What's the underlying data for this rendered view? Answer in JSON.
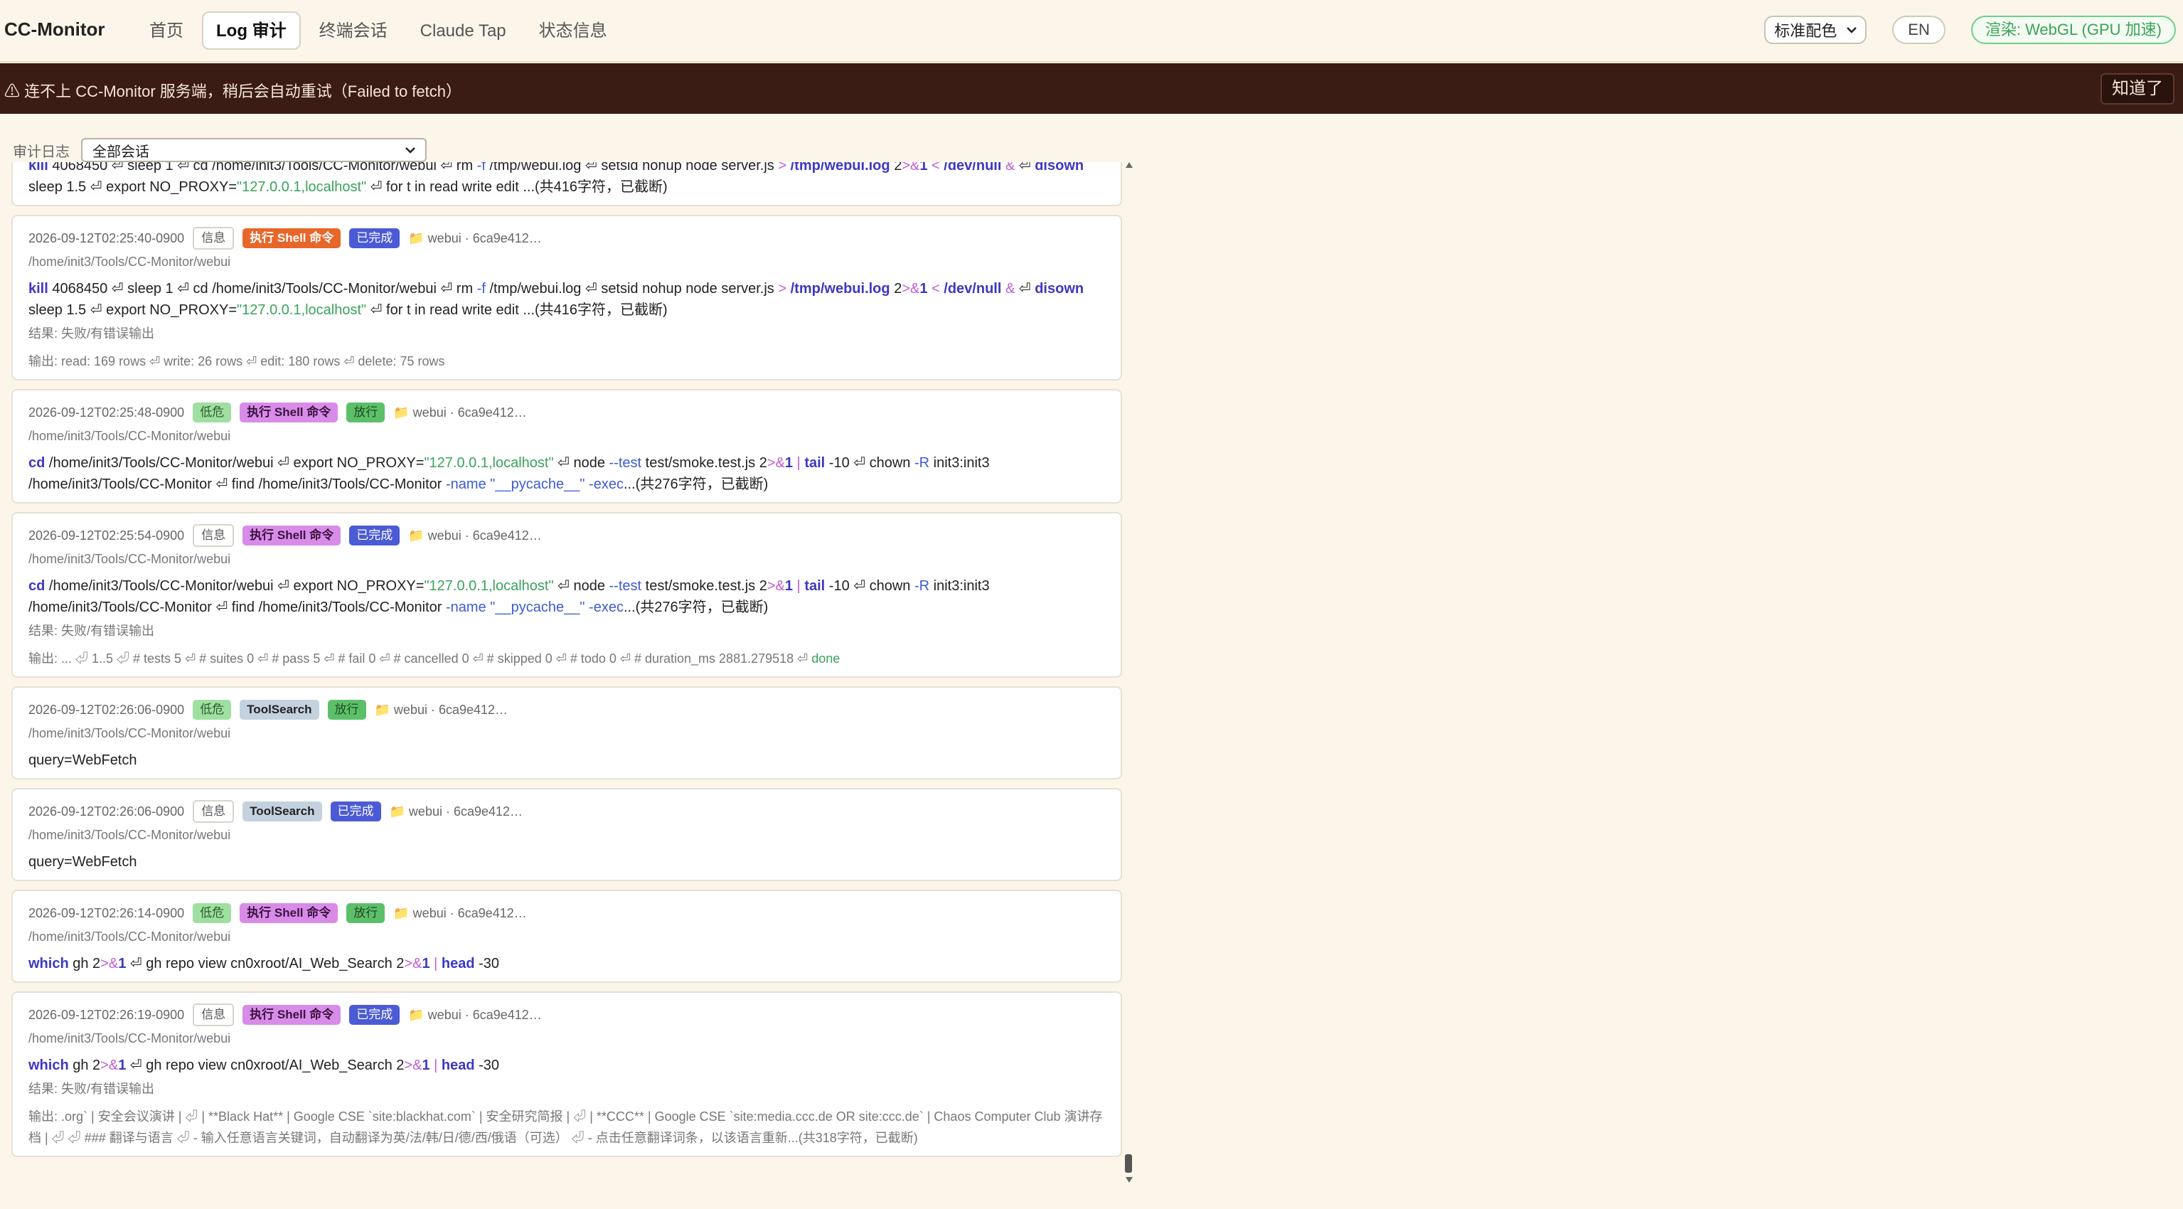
{
  "nav": {
    "brand": "CC-Monitor",
    "tabs": [
      {
        "label": "首页"
      },
      {
        "label": "Log 审计",
        "active": true
      },
      {
        "label": "终端会话"
      },
      {
        "label": "Claude Tap"
      },
      {
        "label": "状态信息"
      }
    ],
    "theme_select": "标准配色",
    "lang_button": "EN",
    "render_badge": "渲染: WebGL (GPU 加速)"
  },
  "banner": {
    "message": "⚠ 连不上 CC-Monitor 服务端，稍后会自动重试（Failed to fetch）",
    "ack_button": "知道了"
  },
  "filter": {
    "label": "审计日志",
    "selected": "全部会话"
  },
  "colors": {
    "accent_blue": "#4b5bd6",
    "danger_banner": "#3a1c15",
    "allow_green": "#5cc06a",
    "low_risk": "#9fe0a0",
    "shell_pink": "#d98be8",
    "shell_orange": "#e8662a"
  },
  "entries": [
    {
      "partial": true,
      "cmd_line1": "kill 4068450 ⏎ sleep 1 ⏎ cd /home/init3/Tools/CC-Monitor/webui ⏎ rm -f /tmp/webui.log ⏎ setsid nohup node server.js > /tmp/webui.log 2>&1 < /dev/null & ⏎ disown",
      "cmd_line2": "sleep 1.5 ⏎ export NO_PROXY=\"127.0.0.1,localhost\" ⏎ for t in read write edit ...(共416字符，已截断)"
    },
    {
      "time": "2026-09-12T02:25:40-0900",
      "level": "信息",
      "tool": "执行 Shell 命令",
      "status": "已完成",
      "folder": "📁 webui · 6ca9e412…",
      "path": "/home/init3/Tools/CC-Monitor/webui",
      "result": "结果: 失败/有错误输出",
      "output": "输出: read: 169 rows ⏎ write: 26 rows ⏎ edit: 180 rows ⏎ delete: 75 rows"
    },
    {
      "time": "2026-09-12T02:25:48-0900",
      "level": "低危",
      "tool": "执行 Shell 命令",
      "status": "放行",
      "folder": "📁 webui · 6ca9e412…",
      "path": "/home/init3/Tools/CC-Monitor/webui"
    },
    {
      "time": "2026-09-12T02:25:54-0900",
      "level": "信息",
      "tool": "执行 Shell 命令",
      "status": "已完成",
      "folder": "📁 webui · 6ca9e412…",
      "path": "/home/init3/Tools/CC-Monitor/webui",
      "result": "结果: 失败/有错误输出",
      "output_prefix": "输出: ... ⏎ 1..5 ⏎ # tests 5 ⏎ # suites 0 ⏎ # pass 5 ⏎ # fail 0 ⏎ # cancelled 0 ⏎ # skipped 0 ⏎ # todo 0 ⏎ # duration_ms 2881.279518 ⏎ ",
      "output_done": "done"
    },
    {
      "time": "2026-09-12T02:26:06-0900",
      "level": "低危",
      "tool": "ToolSearch",
      "status": "放行",
      "folder": "📁 webui · 6ca9e412…",
      "path": "/home/init3/Tools/CC-Monitor/webui",
      "cmd": "query=WebFetch"
    },
    {
      "time": "2026-09-12T02:26:06-0900",
      "level": "信息",
      "tool": "ToolSearch",
      "status": "已完成",
      "folder": "📁 webui · 6ca9e412…",
      "path": "/home/init3/Tools/CC-Monitor/webui",
      "cmd": "query=WebFetch"
    },
    {
      "time": "2026-09-12T02:26:14-0900",
      "level": "低危",
      "tool": "执行 Shell 命令",
      "status": "放行",
      "folder": "📁 webui · 6ca9e412…",
      "path": "/home/init3/Tools/CC-Monitor/webui"
    },
    {
      "time": "2026-09-12T02:26:19-0900",
      "level": "信息",
      "tool": "执行 Shell 命令",
      "status": "已完成",
      "folder": "📁 webui · 6ca9e412…",
      "path": "/home/init3/Tools/CC-Monitor/webui",
      "result": "结果: 失败/有错误输出",
      "output": "输出: .org` | 安全会议演讲 | ⏎ | **Black Hat** | Google CSE `site:blackhat.com` | 安全研究简报 | ⏎ | **CCC** | Google CSE `site:media.ccc.de OR site:ccc.de` | Chaos Computer Club 演讲存档 | ⏎ ⏎ ### 翻译与语言 ⏎ - 输入任意语言关键词，自动翻译为英/法/韩/日/德/西/俄语（可选） ⏎ - 点击任意翻译词条，以该语言重新...(共318字符，已截断)"
    }
  ],
  "tokens": {
    "kill": "kill",
    "pid": "4068450",
    "nl": "⏎",
    "sleep": "sleep",
    "one": "1",
    "cd": "cd",
    "webui_dir": "/home/init3/Tools/CC-Monitor/webui",
    "rm": "rm",
    "f_flag": "-f",
    "tmp_log": "/tmp/webui.log",
    "setsid": "setsid nohup node server.js",
    "gt": ">",
    "two": "2",
    "amp_gt": ">&",
    "lt": "<",
    "devnull": "/dev/null",
    "amp": "&",
    "disown": "disown",
    "sleep15": "1.5",
    "export": "export NO_PROXY=",
    "proxy_val": "\"127.0.0.1,localhost\"",
    "for_t": "for t in read write edit ...(共416字符，已截断)",
    "node": "node",
    "test_flag": "--test",
    "smoke": "test/smoke.test.js",
    "pipe": "|",
    "tail": "tail",
    "ten": "-10",
    "chown": "chown",
    "r_flag": "-R",
    "owner": "init3:init3",
    "cc_dir": "/home/init3/Tools/CC-Monitor",
    "find": "find",
    "name_flag": "-name",
    "pycache": "\"__pycache__\"",
    "exec_flag": "-exec",
    "trunc276": "...(共276字符，已截断)",
    "which": "which",
    "gh": "gh",
    "gh_repo": "gh repo view cn0xroot/AI_Web_Search",
    "head": "head",
    "thirty": "-30"
  }
}
